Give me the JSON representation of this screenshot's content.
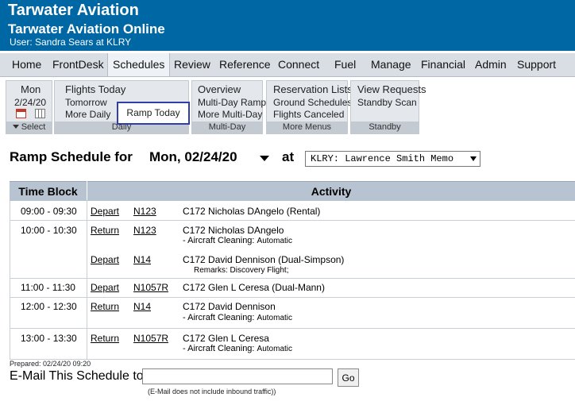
{
  "header": {
    "title": "Tarwater Aviation",
    "subtitle": "Tarwater Aviation Online",
    "user_line": "User:  Sandra Sears at KLRY"
  },
  "nav": [
    "Home",
    "FrontDesk",
    "Schedules",
    "Review",
    "Reference",
    "Connect",
    "Fuel",
    "Manage",
    "Financial",
    "Admin",
    "Support"
  ],
  "nav_active": "Schedules",
  "ribbon": {
    "date_group": {
      "weekday": "Mon",
      "date": "2/24/20",
      "footer": "Select"
    },
    "daily": {
      "items": [
        "Flights Today",
        "Tomorrow",
        "More Daily",
        "Ramp Today"
      ],
      "footer": "Daily"
    },
    "multiday": {
      "items": [
        "Overview",
        "Multi-Day Ramp",
        "More Multi-Day"
      ],
      "footer": "Multi-Day"
    },
    "more_menus": {
      "items": [
        "Reservation Lists",
        "Ground Schedules",
        "Flights Canceled"
      ],
      "footer": "More Menus"
    },
    "standby": {
      "items": [
        "View Requests",
        "Standby Scan"
      ],
      "footer": "Standby"
    }
  },
  "page": {
    "title": "Ramp Schedule for",
    "date": "Mon, 02/24/20",
    "at": "at",
    "airport_select": "KLRY: Lawrence Smith Memo"
  },
  "table": {
    "headers": [
      "Time Block",
      "Activity"
    ],
    "rows": [
      {
        "time": "09:00 - 09:30",
        "entries": [
          {
            "action": "Depart",
            "tail": "N123",
            "desc": "C172 Nicholas DAngelo (Rental)"
          }
        ]
      },
      {
        "time": "10:00 - 10:30",
        "entries": [
          {
            "action": "Return",
            "tail": "N123",
            "desc": "C172 Nicholas DAngelo",
            "sub": "- Aircraft Cleaning:",
            "sub2": "Automatic"
          },
          {
            "action": "Depart",
            "tail": "N14",
            "desc": "C172 David Dennison (Dual-Simpson)",
            "remarks": "Remarks: Discovery Flight;"
          }
        ]
      },
      {
        "time": "11:00 - 11:30",
        "entries": [
          {
            "action": "Depart",
            "tail": "N1057R",
            "desc": "C172 Glen L Ceresa (Dual-Mann)"
          }
        ]
      },
      {
        "time": "12:00 - 12:30",
        "entries": [
          {
            "action": "Return",
            "tail": "N14",
            "desc": "C172 David Dennison",
            "sub": "- Aircraft Cleaning:",
            "sub2": "Automatic"
          }
        ]
      },
      {
        "time": "13:00 - 13:30",
        "entries": [
          {
            "action": "Return",
            "tail": "N1057R",
            "desc": "C172 Glen L Ceresa",
            "sub": "- Aircraft Cleaning:",
            "sub2": "Automatic"
          }
        ]
      }
    ]
  },
  "footer": {
    "prepared": "Prepared: 02/24/20 09:20",
    "email_label": "E-Mail This Schedule to:",
    "email_value": "",
    "go": "Go",
    "note": "(E-Mail does not include inbound traffic))"
  },
  "colors": {
    "header_bg": "#0067a5",
    "nav_bg": "#d9dee4",
    "table_header_bg": "#b7c3d0",
    "highlight_border": "#2f3ea8"
  },
  "icons": [
    "calendar-icon",
    "grid-icon",
    "dropdown-caret-icon"
  ]
}
